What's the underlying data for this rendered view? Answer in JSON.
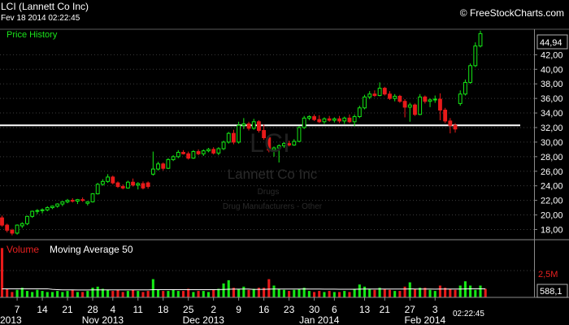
{
  "header": {
    "title": "LCI (Lannett Co Inc)",
    "date": "Fev 18 2014 02:22:45",
    "credit": "© FreeStockCharts.com"
  },
  "watermark": {
    "ticker": "LCI",
    "company": "Lannett Co Inc",
    "sector": "Drugs",
    "industry": "Drug Manufacturers - Other"
  },
  "price_panel": {
    "label": "Price History"
  },
  "volume_panel": {
    "title": "Volume",
    "ma_label": "Moving Average 50",
    "axis_label": "2,5M",
    "badge": "588,1"
  },
  "time_label": "02:22:45",
  "colors": {
    "up": "#15e815",
    "down": "#e81a1a",
    "hline": "#ffffff",
    "grid": "#3c3c3c",
    "badge_border": "#b0b0b0"
  },
  "chart_data": {
    "type": "candlestick",
    "title": "LCI (Lannett Co Inc)",
    "x_tick_labels": [
      "7",
      "14",
      "21",
      "28",
      "4",
      "11",
      "18",
      "25",
      "2",
      "9",
      "16",
      "23",
      "30",
      "6",
      "13",
      "21",
      "27",
      "3"
    ],
    "month_labels": [
      "2013",
      "Nov 2013",
      "Dec 2013",
      "Jan 2014",
      "Feb 2014"
    ],
    "y_ticks": [
      "18,00",
      "20,00",
      "22,00",
      "24,00",
      "26,00",
      "28,00",
      "30,00",
      "32,00",
      "34,00",
      "36,00",
      "38,00",
      "40,00",
      "42,00"
    ],
    "ylim": [
      16.6,
      45.5
    ],
    "last_price": 44.94,
    "last_price_label": "44,94",
    "horizontal_line": 32.3,
    "grid": true,
    "candles": [
      {
        "d": "Oct 2",
        "o": 19.6,
        "h": 19.9,
        "l": 18.4,
        "c": 18.6
      },
      {
        "d": "Oct 3",
        "o": 18.6,
        "h": 18.8,
        "l": 17.6,
        "c": 17.9
      },
      {
        "d": "Oct 4",
        "o": 17.9,
        "h": 18.1,
        "l": 17.2,
        "c": 17.5
      },
      {
        "d": "Oct 7",
        "o": 17.5,
        "h": 18.7,
        "l": 17.3,
        "c": 18.6
      },
      {
        "d": "Oct 8",
        "o": 18.5,
        "h": 19.0,
        "l": 18.2,
        "c": 18.8
      },
      {
        "d": "Oct 9",
        "o": 18.8,
        "h": 19.9,
        "l": 18.6,
        "c": 19.8
      },
      {
        "d": "Oct 10",
        "o": 19.8,
        "h": 20.6,
        "l": 19.6,
        "c": 20.5
      },
      {
        "d": "Oct 11",
        "o": 20.5,
        "h": 20.8,
        "l": 20.1,
        "c": 20.6
      },
      {
        "d": "Oct 14",
        "o": 20.6,
        "h": 20.9,
        "l": 20.2,
        "c": 20.7
      },
      {
        "d": "Oct 15",
        "o": 20.7,
        "h": 21.2,
        "l": 20.5,
        "c": 21.0
      },
      {
        "d": "Oct 16",
        "o": 21.0,
        "h": 21.3,
        "l": 20.8,
        "c": 21.2
      },
      {
        "d": "Oct 17",
        "o": 21.2,
        "h": 21.6,
        "l": 21.0,
        "c": 21.5
      },
      {
        "d": "Oct 18",
        "o": 21.5,
        "h": 21.9,
        "l": 21.2,
        "c": 21.8
      },
      {
        "d": "Oct 21",
        "o": 21.8,
        "h": 22.2,
        "l": 21.6,
        "c": 22.0
      },
      {
        "d": "Oct 22",
        "o": 22.0,
        "h": 22.3,
        "l": 21.7,
        "c": 21.9
      },
      {
        "d": "Oct 23",
        "o": 21.9,
        "h": 22.2,
        "l": 21.5,
        "c": 22.1
      },
      {
        "d": "Oct 24",
        "o": 22.1,
        "h": 22.4,
        "l": 21.8,
        "c": 22.0
      },
      {
        "d": "Oct 25",
        "o": 21.6,
        "h": 21.9,
        "l": 21.3,
        "c": 21.8
      },
      {
        "d": "Oct 28",
        "o": 21.8,
        "h": 23.0,
        "l": 21.7,
        "c": 22.9
      },
      {
        "d": "Oct 29",
        "o": 22.9,
        "h": 24.4,
        "l": 22.8,
        "c": 24.2
      },
      {
        "d": "Oct 30",
        "o": 24.2,
        "h": 24.9,
        "l": 24.0,
        "c": 24.6
      },
      {
        "d": "Oct 31",
        "o": 24.6,
        "h": 25.6,
        "l": 24.4,
        "c": 25.2
      },
      {
        "d": "Nov 1",
        "o": 25.2,
        "h": 25.4,
        "l": 24.2,
        "c": 24.4
      },
      {
        "d": "Nov 4",
        "o": 24.4,
        "h": 24.6,
        "l": 23.7,
        "c": 23.9
      },
      {
        "d": "Nov 5",
        "o": 23.9,
        "h": 24.2,
        "l": 23.5,
        "c": 23.7
      },
      {
        "d": "Nov 6",
        "o": 23.7,
        "h": 24.7,
        "l": 23.6,
        "c": 24.5
      },
      {
        "d": "Nov 7",
        "o": 24.5,
        "h": 25.0,
        "l": 23.9,
        "c": 24.1
      },
      {
        "d": "Nov 8",
        "o": 24.1,
        "h": 24.5,
        "l": 23.5,
        "c": 24.3
      },
      {
        "d": "Nov 11",
        "o": 24.3,
        "h": 24.6,
        "l": 23.5,
        "c": 23.7
      },
      {
        "d": "Nov 12",
        "o": 24.4,
        "h": 24.6,
        "l": 23.6,
        "c": 23.9
      },
      {
        "d": "Nov 13",
        "o": 25.6,
        "h": 28.7,
        "l": 25.4,
        "c": 26.3
      },
      {
        "d": "Nov 14",
        "o": 26.3,
        "h": 27.3,
        "l": 26.1,
        "c": 27.0
      },
      {
        "d": "Nov 15",
        "o": 27.0,
        "h": 27.2,
        "l": 26.1,
        "c": 26.4
      },
      {
        "d": "Nov 18",
        "o": 26.4,
        "h": 27.8,
        "l": 26.3,
        "c": 27.6
      },
      {
        "d": "Nov 19",
        "o": 27.6,
        "h": 28.2,
        "l": 27.4,
        "c": 28.0
      },
      {
        "d": "Nov 20",
        "o": 28.0,
        "h": 28.9,
        "l": 27.8,
        "c": 28.6
      },
      {
        "d": "Nov 21",
        "o": 28.6,
        "h": 28.9,
        "l": 28.3,
        "c": 28.4
      },
      {
        "d": "Nov 22",
        "o": 28.4,
        "h": 28.7,
        "l": 27.6,
        "c": 27.8
      },
      {
        "d": "Nov 25",
        "o": 27.8,
        "h": 28.9,
        "l": 27.7,
        "c": 28.7
      },
      {
        "d": "Nov 26",
        "o": 28.7,
        "h": 29.0,
        "l": 28.2,
        "c": 28.4
      },
      {
        "d": "Nov 27",
        "o": 28.4,
        "h": 29.0,
        "l": 28.1,
        "c": 28.8
      },
      {
        "d": "Nov 29",
        "o": 28.8,
        "h": 29.2,
        "l": 28.6,
        "c": 29.0
      },
      {
        "d": "Dec 2",
        "o": 29.0,
        "h": 29.3,
        "l": 28.3,
        "c": 28.5
      },
      {
        "d": "Dec 3",
        "o": 28.5,
        "h": 29.3,
        "l": 28.2,
        "c": 29.1
      },
      {
        "d": "Dec 4",
        "o": 29.1,
        "h": 30.2,
        "l": 28.9,
        "c": 30.0
      },
      {
        "d": "Dec 5",
        "o": 30.0,
        "h": 31.4,
        "l": 29.8,
        "c": 31.2
      },
      {
        "d": "Dec 6",
        "o": 31.2,
        "h": 31.7,
        "l": 29.7,
        "c": 30.0
      },
      {
        "d": "Dec 9",
        "o": 30.0,
        "h": 32.8,
        "l": 29.8,
        "c": 32.3
      },
      {
        "d": "Dec 10",
        "o": 32.3,
        "h": 33.3,
        "l": 31.8,
        "c": 32.5
      },
      {
        "d": "Dec 11",
        "o": 32.5,
        "h": 32.8,
        "l": 31.6,
        "c": 31.9
      },
      {
        "d": "Dec 12",
        "o": 31.9,
        "h": 33.2,
        "l": 31.7,
        "c": 32.8
      },
      {
        "d": "Dec 13",
        "o": 32.8,
        "h": 33.0,
        "l": 31.3,
        "c": 31.6
      },
      {
        "d": "Dec 16",
        "o": 31.6,
        "h": 32.4,
        "l": 30.3,
        "c": 30.6
      },
      {
        "d": "Dec 17",
        "o": 30.6,
        "h": 30.9,
        "l": 28.6,
        "c": 28.9
      },
      {
        "d": "Dec 18",
        "o": 28.9,
        "h": 29.4,
        "l": 28.0,
        "c": 29.2
      },
      {
        "d": "Dec 19",
        "o": 29.2,
        "h": 29.7,
        "l": 27.2,
        "c": 29.5
      },
      {
        "d": "Dec 20",
        "o": 29.5,
        "h": 30.0,
        "l": 29.2,
        "c": 29.8
      },
      {
        "d": "Dec 23",
        "o": 29.8,
        "h": 30.2,
        "l": 29.4,
        "c": 29.6
      },
      {
        "d": "Dec 24",
        "o": 29.6,
        "h": 30.4,
        "l": 29.5,
        "c": 30.1
      },
      {
        "d": "Dec 26",
        "o": 30.1,
        "h": 32.2,
        "l": 30.0,
        "c": 32.0
      },
      {
        "d": "Dec 27",
        "o": 32.0,
        "h": 33.6,
        "l": 31.8,
        "c": 33.3
      },
      {
        "d": "Dec 30",
        "o": 33.3,
        "h": 33.7,
        "l": 33.0,
        "c": 33.5
      },
      {
        "d": "Dec 31",
        "o": 33.5,
        "h": 33.8,
        "l": 32.9,
        "c": 33.1
      },
      {
        "d": "Jan 2",
        "o": 33.1,
        "h": 33.7,
        "l": 32.6,
        "c": 32.8
      },
      {
        "d": "Jan 3",
        "o": 32.8,
        "h": 33.4,
        "l": 32.5,
        "c": 33.2
      },
      {
        "d": "Jan 6",
        "o": 33.2,
        "h": 33.6,
        "l": 32.8,
        "c": 33.0
      },
      {
        "d": "Jan 7",
        "o": 33.0,
        "h": 33.4,
        "l": 32.7,
        "c": 33.2
      },
      {
        "d": "Jan 8",
        "o": 33.2,
        "h": 33.6,
        "l": 32.6,
        "c": 32.9
      },
      {
        "d": "Jan 9",
        "o": 32.9,
        "h": 33.5,
        "l": 32.5,
        "c": 33.3
      },
      {
        "d": "Jan 10",
        "o": 33.3,
        "h": 33.8,
        "l": 32.6,
        "c": 32.8
      },
      {
        "d": "Jan 13",
        "o": 32.8,
        "h": 33.8,
        "l": 32.2,
        "c": 33.5
      },
      {
        "d": "Jan 14",
        "o": 33.5,
        "h": 35.0,
        "l": 33.3,
        "c": 34.7
      },
      {
        "d": "Jan 15",
        "o": 34.7,
        "h": 36.5,
        "l": 34.5,
        "c": 36.2
      },
      {
        "d": "Jan 16",
        "o": 36.2,
        "h": 37.0,
        "l": 35.9,
        "c": 36.6
      },
      {
        "d": "Jan 17",
        "o": 36.6,
        "h": 37.1,
        "l": 36.2,
        "c": 36.4
      },
      {
        "d": "Jan 21",
        "o": 36.4,
        "h": 38.2,
        "l": 36.3,
        "c": 37.4
      },
      {
        "d": "Jan 22",
        "o": 37.4,
        "h": 37.6,
        "l": 36.4,
        "c": 36.6
      },
      {
        "d": "Jan 23",
        "o": 36.6,
        "h": 37.0,
        "l": 35.8,
        "c": 36.0
      },
      {
        "d": "Jan 24",
        "o": 36.0,
        "h": 36.6,
        "l": 35.6,
        "c": 36.3
      },
      {
        "d": "Jan 27",
        "o": 36.3,
        "h": 36.5,
        "l": 35.4,
        "c": 35.6
      },
      {
        "d": "Jan 28",
        "o": 35.6,
        "h": 35.9,
        "l": 33.4,
        "c": 34.8
      },
      {
        "d": "Jan 29",
        "o": 34.8,
        "h": 35.4,
        "l": 32.8,
        "c": 35.1
      },
      {
        "d": "Jan 30",
        "o": 35.1,
        "h": 35.3,
        "l": 33.6,
        "c": 33.8
      },
      {
        "d": "Jan 31",
        "o": 33.8,
        "h": 36.6,
        "l": 33.7,
        "c": 36.2
      },
      {
        "d": "Feb 3",
        "o": 36.2,
        "h": 36.4,
        "l": 35.3,
        "c": 35.6
      },
      {
        "d": "Feb 4",
        "o": 35.6,
        "h": 36.0,
        "l": 34.8,
        "c": 35.8
      },
      {
        "d": "Feb 5",
        "o": 35.8,
        "h": 36.4,
        "l": 35.4,
        "c": 35.9
      },
      {
        "d": "Feb 6",
        "o": 35.9,
        "h": 36.7,
        "l": 33.0,
        "c": 34.4
      },
      {
        "d": "Feb 7",
        "o": 34.4,
        "h": 34.7,
        "l": 32.6,
        "c": 32.9
      },
      {
        "d": "Feb 10",
        "o": 32.9,
        "h": 33.3,
        "l": 31.2,
        "c": 32.3
      },
      {
        "d": "Feb 11",
        "o": 32.3,
        "h": 32.6,
        "l": 31.3,
        "c": 31.8
      },
      {
        "d": "Feb 12",
        "o": 35.3,
        "h": 37.1,
        "l": 35.0,
        "c": 36.6
      },
      {
        "d": "Feb 13",
        "o": 36.6,
        "h": 38.6,
        "l": 36.4,
        "c": 38.2
      },
      {
        "d": "Feb 14",
        "o": 38.2,
        "h": 40.8,
        "l": 38.0,
        "c": 40.5
      },
      {
        "d": "Feb 17",
        "o": 40.5,
        "h": 43.7,
        "l": 40.3,
        "c": 43.2
      },
      {
        "d": "Feb 18",
        "o": 43.2,
        "h": 45.3,
        "l": 43.0,
        "c": 44.9
      }
    ],
    "volume": {
      "axis_ticks": [
        "2,5M"
      ],
      "ma_period": 50,
      "values": [
        4.6,
        0.8,
        0.5,
        0.7,
        0.9,
        0.6,
        0.5,
        0.7,
        0.6,
        0.5,
        0.5,
        0.6,
        0.5,
        0.6,
        0.7,
        0.5,
        0.5,
        0.6,
        0.9,
        1.0,
        0.8,
        0.7,
        0.6,
        0.7,
        0.5,
        0.6,
        0.7,
        0.6,
        0.5,
        0.6,
        1.7,
        0.7,
        0.6,
        0.6,
        0.7,
        0.6,
        0.6,
        0.8,
        0.5,
        0.6,
        0.6,
        0.5,
        0.7,
        0.8,
        1.3,
        1.6,
        0.9,
        0.8,
        1.0,
        0.7,
        0.8,
        0.9,
        0.9,
        1.7,
        1.1,
        0.8,
        0.7,
        0.6,
        0.7,
        0.8,
        0.9,
        0.6,
        0.5,
        0.6,
        0.5,
        0.6,
        0.5,
        0.5,
        0.6,
        0.5,
        0.8,
        1.2,
        1.0,
        0.8,
        0.7,
        0.9,
        0.8,
        0.7,
        0.6,
        0.6,
        1.0,
        1.4,
        0.8,
        0.9,
        0.9,
        0.7,
        0.6,
        1.1,
        0.9,
        0.8,
        0.7,
        1.1,
        1.5,
        1.1,
        0.7,
        1.1,
        0.8
      ],
      "ma_values": [
        0.8,
        0.8,
        0.8,
        0.8,
        0.8,
        0.8,
        0.8,
        0.8,
        0.8,
        0.8,
        0.75,
        0.72,
        0.7,
        0.7,
        0.7,
        0.69,
        0.69,
        0.69,
        0.7,
        0.7,
        0.7,
        0.7,
        0.7,
        0.7,
        0.7,
        0.7,
        0.7,
        0.7,
        0.7,
        0.7,
        0.72,
        0.72,
        0.72,
        0.72,
        0.72,
        0.72,
        0.72,
        0.72,
        0.72,
        0.72,
        0.72,
        0.72,
        0.72,
        0.73,
        0.74,
        0.76,
        0.77,
        0.77,
        0.78,
        0.78,
        0.74,
        0.75,
        0.75,
        0.77,
        0.78,
        0.78,
        0.78,
        0.78,
        0.78,
        0.78,
        0.79,
        0.78,
        0.78,
        0.78,
        0.77,
        0.77,
        0.77,
        0.76,
        0.76,
        0.76,
        0.76,
        0.77,
        0.78,
        0.78,
        0.78,
        0.78,
        0.78,
        0.78,
        0.78,
        0.78,
        0.78,
        0.79,
        0.78,
        0.78,
        0.78,
        0.78,
        0.77,
        0.78,
        0.78,
        0.78,
        0.78,
        0.78,
        0.79,
        0.8,
        0.8,
        0.8,
        0.8
      ]
    }
  }
}
